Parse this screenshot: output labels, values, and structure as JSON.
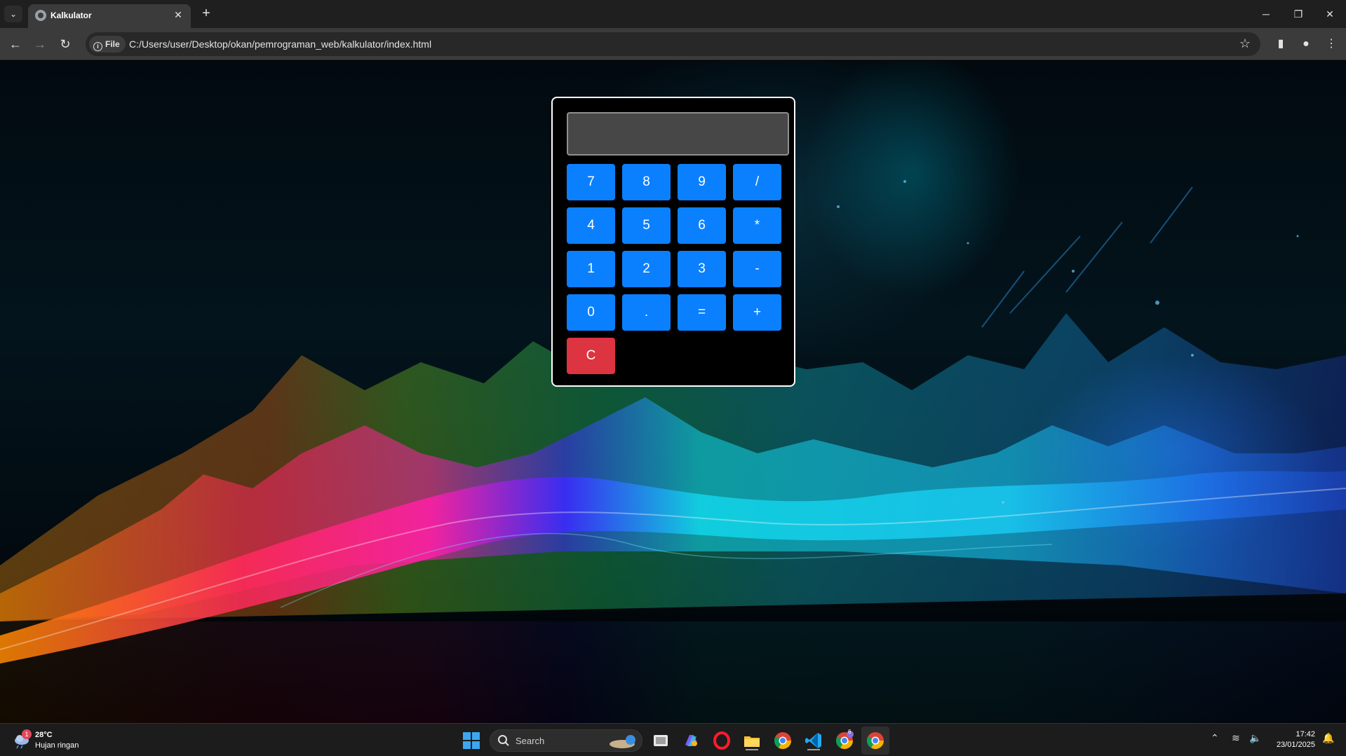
{
  "browser": {
    "tab_title": "Kalkulator",
    "file_chip": "File",
    "url": "C:/Users/user/Desktop/okan/pemrograman_web/kalkulator/index.html"
  },
  "calculator": {
    "display_value": "",
    "keys": [
      "7",
      "8",
      "9",
      "/",
      "4",
      "5",
      "6",
      "*",
      "1",
      "2",
      "3",
      "-",
      "0",
      ".",
      "=",
      "+"
    ],
    "clear_label": "C",
    "colors": {
      "key": "#0a80ff",
      "clear": "#dc3440",
      "display": "#474747"
    }
  },
  "taskbar": {
    "weather_temp": "28°C",
    "weather_desc": "Hujan ringan",
    "weather_badge": "1",
    "search_label": "Search",
    "time": "17:42",
    "date": "23/01/2025",
    "vscode_badge": "6"
  }
}
